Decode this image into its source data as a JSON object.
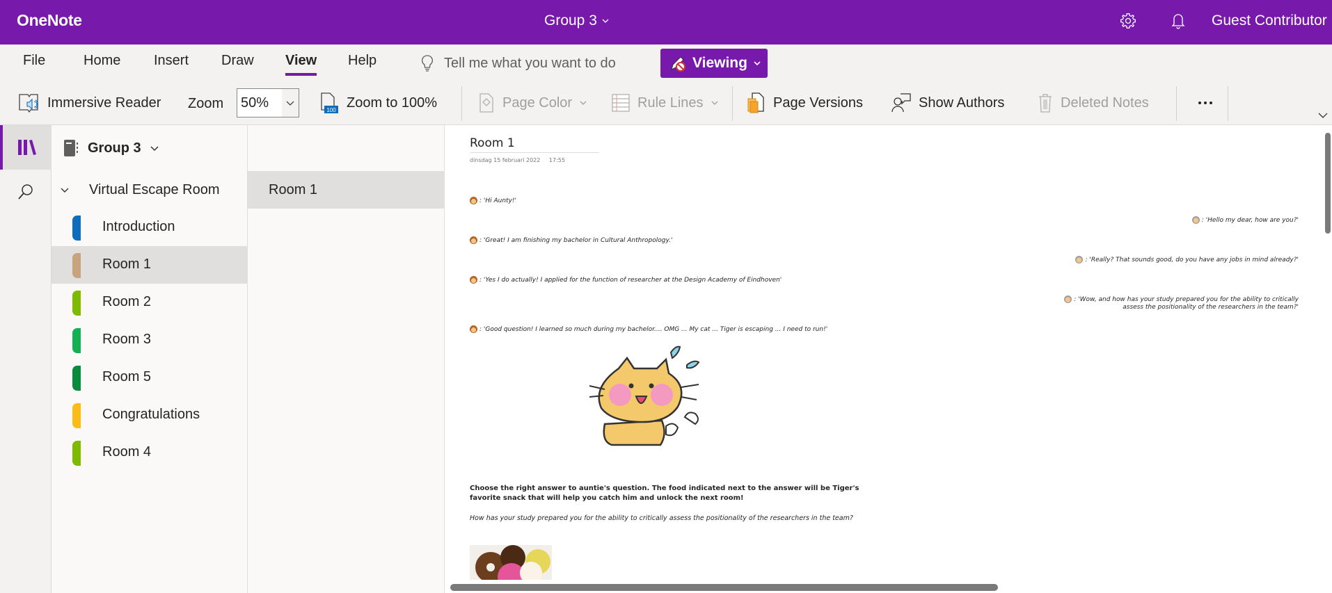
{
  "titlebar": {
    "app_name": "OneNote",
    "notebook_title": "Group 3",
    "user_name": "Guest Contributor",
    "accent_color": "#7719aa"
  },
  "ribbon": {
    "tabs": [
      {
        "label": "File"
      },
      {
        "label": "Home"
      },
      {
        "label": "Insert"
      },
      {
        "label": "Draw"
      },
      {
        "label": "View",
        "active": true
      },
      {
        "label": "Help"
      }
    ],
    "tell_me": "Tell me what you want to do",
    "mode_button": "Viewing",
    "commands": {
      "immersive_reader": "Immersive Reader",
      "zoom_label": "Zoom",
      "zoom_value": "50%",
      "zoom_to_100": "Zoom to 100%",
      "page_color": "Page Color",
      "rule_lines": "Rule Lines",
      "page_versions": "Page Versions",
      "show_authors": "Show Authors",
      "deleted_notes": "Deleted Notes"
    }
  },
  "navigation": {
    "notebook": "Group 3",
    "section_group": "Virtual Escape Room",
    "sections": [
      {
        "label": "Introduction",
        "color": "#0f6cbd"
      },
      {
        "label": "Room 1",
        "color": "#c8a47e",
        "selected": true
      },
      {
        "label": "Room 2",
        "color": "#7fba00"
      },
      {
        "label": "Room 3",
        "color": "#14b053"
      },
      {
        "label": "Room 5",
        "color": "#0a8a3c"
      },
      {
        "label": "Congratulations",
        "color": "#fbbc18"
      },
      {
        "label": "Room 4",
        "color": "#7fba00"
      }
    ],
    "pages": [
      {
        "label": "Room 1",
        "selected": true
      }
    ]
  },
  "page": {
    "title": "Room 1",
    "date": "dinsdag 15 februari 2022",
    "time": "17:55",
    "chat": [
      {
        "speaker": "girl",
        "text": ": 'Hi Aunty!'"
      },
      {
        "speaker": "aunt",
        "text": ": 'Hello my dear, how are you?'"
      },
      {
        "speaker": "girl",
        "text": ": 'Great! I am finishing my bachelor in Cultural Anthropology.'"
      },
      {
        "speaker": "aunt",
        "text": ": 'Really? That sounds good, do you have any jobs in mind already?'"
      },
      {
        "speaker": "girl",
        "text": ": 'Yes I do actually! I applied for the function of researcher at the Design Academy of Eindhoven'"
      },
      {
        "speaker": "aunt",
        "text": ": 'Wow, and how has your study prepared you for the ability to critically",
        "text2": "assess the positionality of the researchers in the team?'"
      },
      {
        "speaker": "girl",
        "text": ": 'Good question! I learned so much during my bachelor.... OMG ... My cat ...  Tiger is escaping ... I need to run!'"
      }
    ],
    "instruction": "Choose the right answer to auntie's question. The food indicated next to the answer will be Tiger's favorite snack that will help you catch him and unlock the next room!",
    "question": "How has your study prepared you for the ability to critically assess the positionality of the researchers in the team?"
  }
}
